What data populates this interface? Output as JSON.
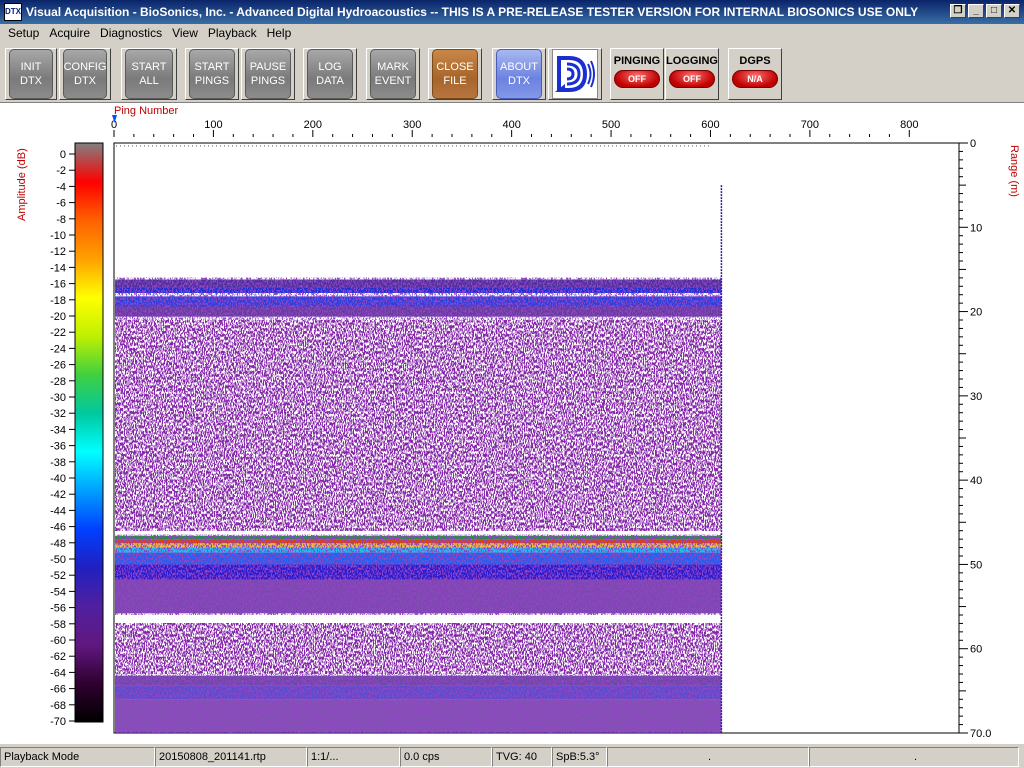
{
  "window": {
    "title": "Visual Acquisition  -  BioSonics, Inc.  -  Advanced Digital Hydroacoustics  -- THIS IS A PRE-RELEASE TESTER VERSION FOR INTERNAL BIOSONICS USE ONLY",
    "icon_text": "DTX",
    "controls": [
      "restore-icon",
      "minimize-icon",
      "maximize-icon",
      "close-icon"
    ]
  },
  "menu": [
    "Setup",
    "Acquire",
    "Diagnostics",
    "View",
    "Playback",
    "Help"
  ],
  "toolbar": {
    "init": [
      "INIT",
      "DTX"
    ],
    "config": [
      "CONFIG",
      "DTX"
    ],
    "start_all": [
      "START",
      "ALL"
    ],
    "start_pings": [
      "START",
      "PINGS"
    ],
    "pause_pings": [
      "PAUSE",
      "PINGS"
    ],
    "log_data": [
      "LOG",
      "DATA"
    ],
    "mark_event": [
      "MARK",
      "EVENT"
    ],
    "close_file": [
      "CLOSE",
      "FILE"
    ],
    "about": [
      "ABOUT",
      "DTX"
    ],
    "logo_icon": "biosonics-logo-icon",
    "pinging": {
      "label": "PINGING",
      "state": "OFF"
    },
    "logging": {
      "label": "LOGGING",
      "state": "OFF"
    },
    "dgps": {
      "label": "DGPS",
      "state": "N/A"
    }
  },
  "colors": {
    "title_start": "#0a246a",
    "title_end": "#3a6ea5",
    "status_off": "#d01010",
    "close_button": "#a8652a",
    "about_button": "#6c82e0",
    "axis_label": "#c00000",
    "logo": "#1a2fd0"
  },
  "echogram": {
    "x_label": "Ping Number",
    "x_ticks": [
      "0",
      "100",
      "200",
      "300",
      "400",
      "500",
      "600",
      "700",
      "800"
    ],
    "x_tick_values": [
      0,
      100,
      200,
      300,
      400,
      500,
      600,
      700,
      800
    ],
    "x_max": 850,
    "y_label": "Range (m)",
    "y_ticks": [
      "0",
      "10",
      "20",
      "30",
      "40",
      "50",
      "60",
      "70.0"
    ],
    "y_tick_values": [
      0,
      10,
      20,
      30,
      40,
      50,
      60,
      70
    ],
    "y_max": 70,
    "pings_recorded": 610,
    "colorbar_label": "Amplitude (dB)",
    "colorbar_ticks": [
      "0",
      "-2",
      "-4",
      "-6",
      "-8",
      "-10",
      "-12",
      "-14",
      "-16",
      "-18",
      "-20",
      "-22",
      "-24",
      "-26",
      "-28",
      "-30",
      "-32",
      "-34",
      "-36",
      "-38",
      "-40",
      "-42",
      "-44",
      "-46",
      "-48",
      "-50",
      "-52",
      "-54",
      "-56",
      "-58",
      "-60",
      "-62",
      "-64",
      "-66",
      "-68",
      "-70"
    ],
    "colorbar_range": [
      0,
      -70
    ],
    "colorbar_colors": [
      "#808080",
      "#ff0000",
      "#ff6000",
      "#ffa000",
      "#ffff00",
      "#c0f000",
      "#40d040",
      "#00c8a0",
      "#00ffff",
      "#00a0ff",
      "#0040ff",
      "#2020c0",
      "#5020a0",
      "#601880",
      "#300030",
      "#000000"
    ],
    "bands": {
      "surface_layer_m": [
        16,
        21
      ],
      "fish_layer_m": [
        46.5,
        56
      ],
      "bottom_layer_m": [
        63,
        70
      ]
    }
  },
  "status": {
    "mode": "Playback Mode",
    "file": "20150808_201141.rtp",
    "ratio": "1:1/...",
    "rate": "0.0 cps",
    "tvg": "TVG: 40",
    "spb": "SpB:5.3°",
    "p1": ".",
    "p2": "."
  }
}
